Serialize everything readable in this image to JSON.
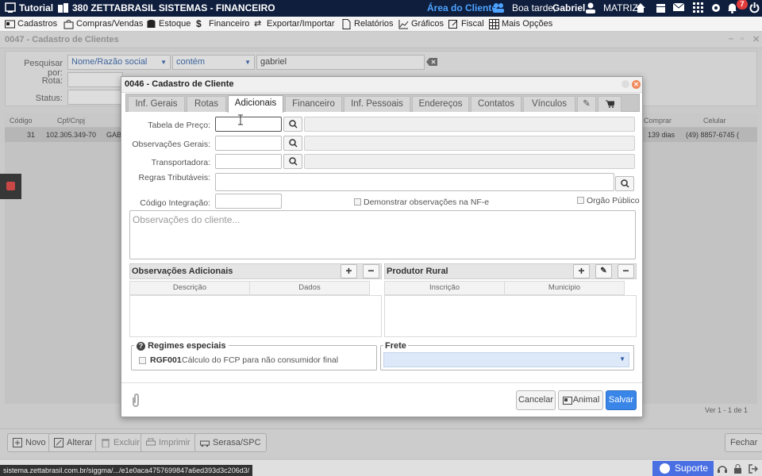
{
  "topbar": {
    "app_title": "Tutorial",
    "company": "380 ZETTABRASIL SISTEMAS - FINANCEIRO",
    "client_area": "Área do Cliente",
    "greeting": "Boa tarde,",
    "user_name": "Gabriel",
    "branch": "MATRIZ",
    "notification_count": "7"
  },
  "menu": {
    "items": [
      "Cadastros",
      "Compras/Vendas",
      "Estoque",
      "Financeiro",
      "Exportar/Importar",
      "Relatórios",
      "Gráficos",
      "Fiscal",
      "Mais Opções"
    ]
  },
  "background": {
    "window_title": "0047 - Cadastro de Clientes",
    "search_label": "Pesquisar por:",
    "search_field": "Nome/Razão social",
    "search_operator": "contém",
    "search_value": "gabriel",
    "route_label": "Rota:",
    "status_label": "Status:",
    "columns": [
      "Código",
      "Cpf/Cnpj",
      "/ Comprar",
      "Celular"
    ],
    "row": {
      "codigo": "31",
      "cpf": "102.305.349-70",
      "name": "GAB",
      "comprar": "139 dias",
      "celular": "(49) 8857-6745 ("
    },
    "pager": "Ver 1 - 1 de 1",
    "toolbar": {
      "novo": "Novo",
      "alterar": "Alterar",
      "excluir": "Excluir",
      "imprimir": "Imprimir",
      "serasa": "Serasa/SPC",
      "fechar": "Fechar"
    },
    "url": "sistema.zettabrasil.com.br/siggma/.../e1e0aca4757699847a6ed393d3c206d3/",
    "suporte": "Suporte"
  },
  "modal": {
    "title": "0046 - Cadastro de Cliente",
    "tabs": [
      "Inf. Gerais",
      "Rotas",
      "Adicionais",
      "Financeiro",
      "Inf. Pessoais",
      "Endereços",
      "Contatos",
      "Vínculos"
    ],
    "active_tab": "Adicionais",
    "fields": {
      "tabela_preco": "Tabela de Preço:",
      "obs_gerais": "Observações Gerais:",
      "transportadora": "Transportadora:",
      "regras": "Regras Tributáveis:",
      "codigo_integracao": "Código Integração:"
    },
    "demonstrar_obs": "Demonstrar observações na NF-e",
    "orgao_publico": "Orgão Público",
    "obs_placeholder": "Observações do cliente...",
    "obs_adicionais": {
      "title": "Observações Adicionais",
      "col1": "Descrição",
      "col2": "Dados"
    },
    "produtor_rural": {
      "title": "Produtor Rural",
      "col1": "Inscrição",
      "col2": "Municipio"
    },
    "regimes": {
      "title": "Regimes especiais",
      "code": "RGF001",
      "desc": "Cálculo do FCP para não consumidor final"
    },
    "frete_label": "Frete",
    "buttons": {
      "cancelar": "Cancelar",
      "animal": "Animal",
      "salvar": "Salvar"
    }
  },
  "colors": {
    "topbar": "#0f1e3d",
    "accent": "#3a86e8",
    "client_area": "#4da3ff",
    "badge": "#e23b3b"
  }
}
